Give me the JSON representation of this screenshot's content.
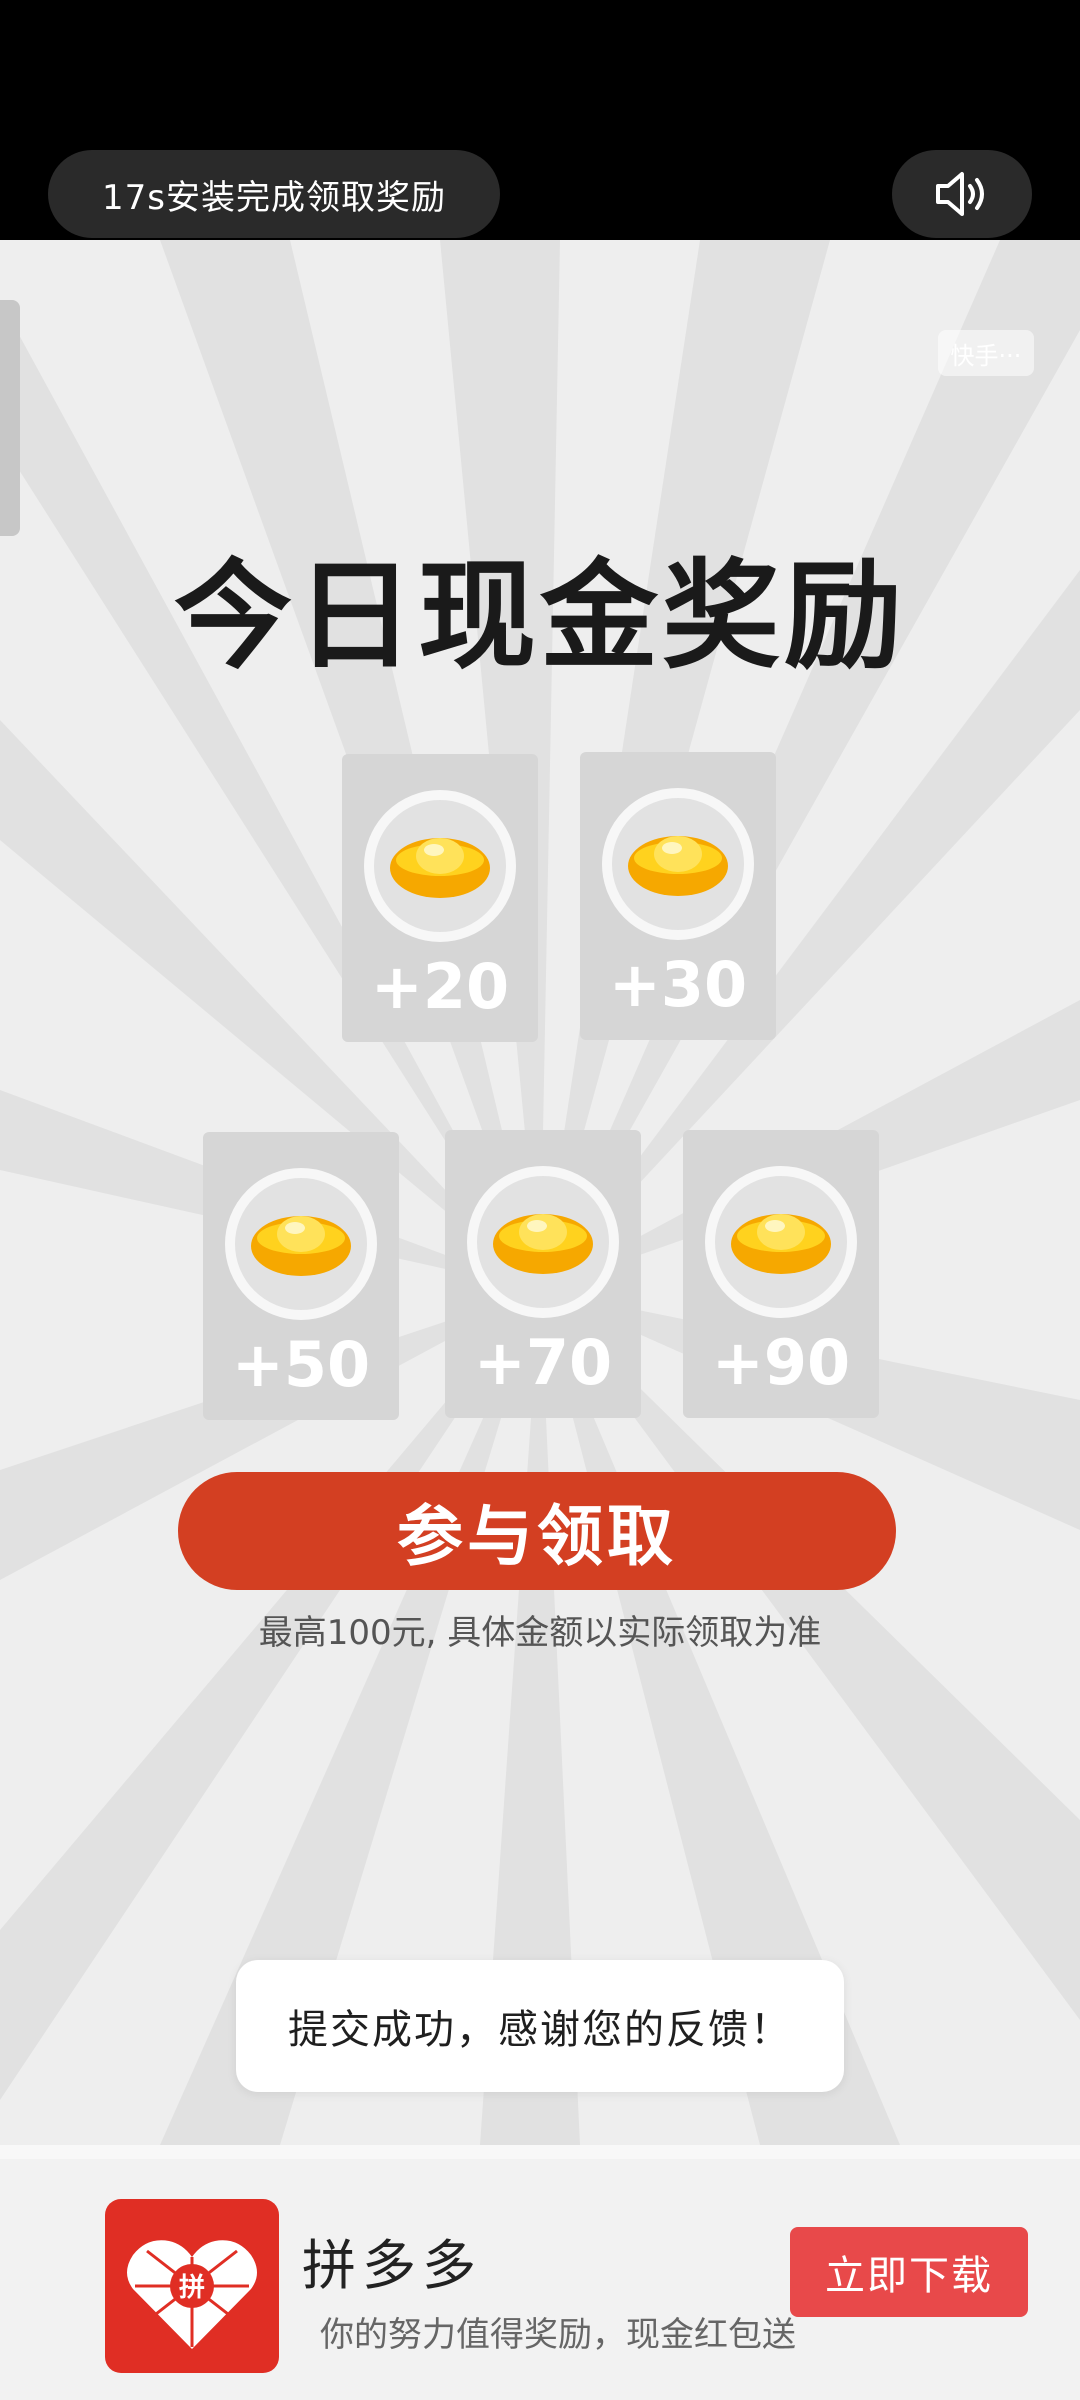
{
  "top_bar": {
    "countdown_text": "17s安装完成领取奖励",
    "sound_icon": "speaker-volume-icon"
  },
  "ad": {
    "sponsor_tag": "快手···",
    "headline": "今日现金奖励",
    "rewards": [
      {
        "amount": "+20",
        "icon": "gold-ingot-icon"
      },
      {
        "amount": "+30",
        "icon": "gold-ingot-icon"
      },
      {
        "amount": "+50",
        "icon": "gold-ingot-icon"
      },
      {
        "amount": "+70",
        "icon": "gold-ingot-icon"
      },
      {
        "amount": "+90",
        "icon": "gold-ingot-icon"
      }
    ],
    "cta_label": "参与领取",
    "disclaimer": "最高100元, 具体金额以实际领取为准",
    "colors": {
      "cta": "#d33f22",
      "background": "#eeeeee",
      "card": "#d6d6d6"
    }
  },
  "toast": {
    "message": "提交成功，感谢您的反馈！"
  },
  "app_banner": {
    "logo_text": "拼",
    "name": "拼多多",
    "slogan": "你的努力值得奖励，现金红包送",
    "download_label": "立即下载",
    "colors": {
      "logo": "#e02e24",
      "download": "#e8494a"
    }
  }
}
